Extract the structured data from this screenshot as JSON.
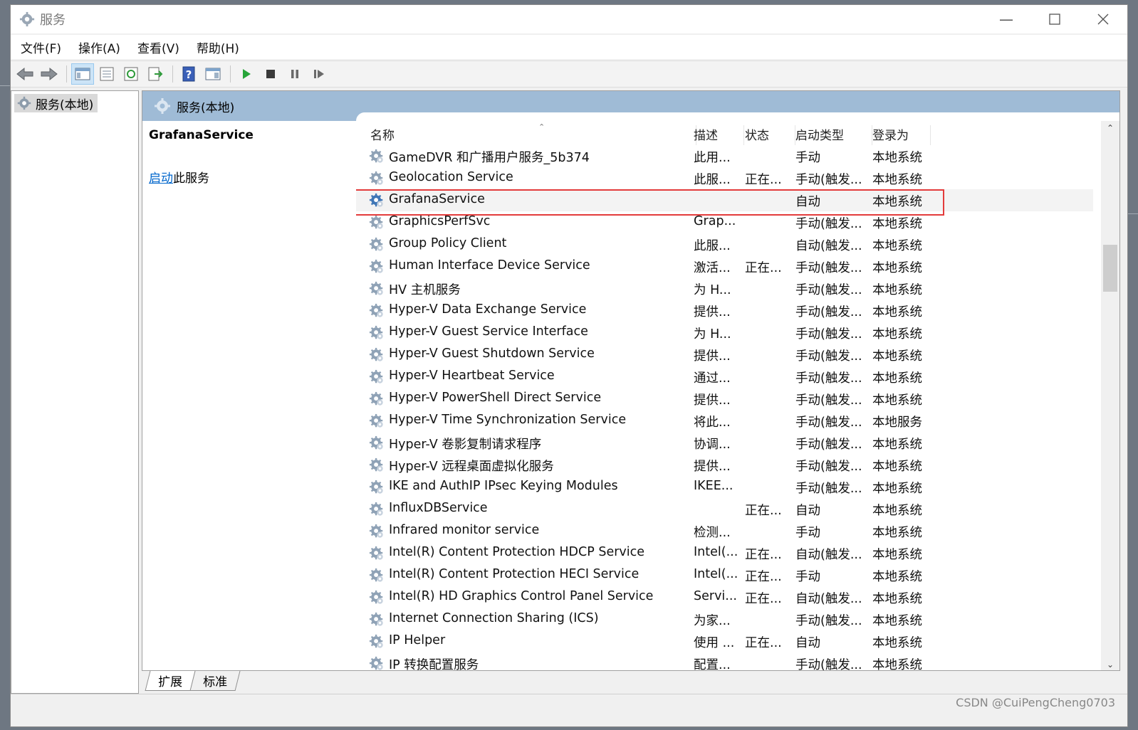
{
  "window": {
    "title": "服务"
  },
  "menu": [
    "文件(F)",
    "操作(A)",
    "查看(V)",
    "帮助(H)"
  ],
  "toolbar_icons": [
    "back-icon",
    "forward-icon",
    "show-tree-icon",
    "properties-icon",
    "refresh-icon",
    "export-list-icon",
    "help-icon",
    "console-tree-icon",
    "start-service-icon",
    "stop-service-icon",
    "pause-service-icon",
    "resume-service-icon"
  ],
  "tree": {
    "root": "服务(本地)"
  },
  "pane": {
    "header": "服务(本地)",
    "selected_name": "GrafanaService",
    "start_link": "启动",
    "start_rest": "此服务"
  },
  "columns": [
    "名称",
    "描述",
    "状态",
    "启动类型",
    "登录为"
  ],
  "rows": [
    {
      "name": "GameDVR 和广播用户服务_5b374",
      "desc": "此用...",
      "status": "",
      "startup": "手动",
      "logon": "本地系统"
    },
    {
      "name": "Geolocation Service",
      "desc": "此服...",
      "status": "正在...",
      "startup": "手动(触发...",
      "logon": "本地系统"
    },
    {
      "name": "GrafanaService",
      "desc": "",
      "status": "",
      "startup": "自动",
      "logon": "本地系统"
    },
    {
      "name": "GraphicsPerfSvc",
      "desc": "Grap...",
      "status": "",
      "startup": "手动(触发...",
      "logon": "本地系统"
    },
    {
      "name": "Group Policy Client",
      "desc": "此服...",
      "status": "",
      "startup": "自动(触发...",
      "logon": "本地系统"
    },
    {
      "name": "Human Interface Device Service",
      "desc": "激活...",
      "status": "正在...",
      "startup": "手动(触发...",
      "logon": "本地系统"
    },
    {
      "name": "HV 主机服务",
      "desc": "为 H...",
      "status": "",
      "startup": "手动(触发...",
      "logon": "本地系统"
    },
    {
      "name": "Hyper-V Data Exchange Service",
      "desc": "提供...",
      "status": "",
      "startup": "手动(触发...",
      "logon": "本地系统"
    },
    {
      "name": "Hyper-V Guest Service Interface",
      "desc": "为 H...",
      "status": "",
      "startup": "手动(触发...",
      "logon": "本地系统"
    },
    {
      "name": "Hyper-V Guest Shutdown Service",
      "desc": "提供...",
      "status": "",
      "startup": "手动(触发...",
      "logon": "本地系统"
    },
    {
      "name": "Hyper-V Heartbeat Service",
      "desc": "通过...",
      "status": "",
      "startup": "手动(触发...",
      "logon": "本地系统"
    },
    {
      "name": "Hyper-V PowerShell Direct Service",
      "desc": "提供...",
      "status": "",
      "startup": "手动(触发...",
      "logon": "本地系统"
    },
    {
      "name": "Hyper-V Time Synchronization Service",
      "desc": "将此...",
      "status": "",
      "startup": "手动(触发...",
      "logon": "本地服务"
    },
    {
      "name": "Hyper-V 卷影复制请求程序",
      "desc": "协调...",
      "status": "",
      "startup": "手动(触发...",
      "logon": "本地系统"
    },
    {
      "name": "Hyper-V 远程桌面虚拟化服务",
      "desc": "提供...",
      "status": "",
      "startup": "手动(触发...",
      "logon": "本地系统"
    },
    {
      "name": "IKE and AuthIP IPsec Keying Modules",
      "desc": "IKEE...",
      "status": "",
      "startup": "手动(触发...",
      "logon": "本地系统"
    },
    {
      "name": "InfluxDBService",
      "desc": "",
      "status": "正在...",
      "startup": "自动",
      "logon": "本地系统"
    },
    {
      "name": "Infrared monitor service",
      "desc": "检测...",
      "status": "",
      "startup": "手动",
      "logon": "本地系统"
    },
    {
      "name": "Intel(R) Content Protection HDCP Service",
      "desc": "Intel(...",
      "status": "正在...",
      "startup": "自动(触发...",
      "logon": "本地系统"
    },
    {
      "name": "Intel(R) Content Protection HECI Service",
      "desc": "Intel(...",
      "status": "正在...",
      "startup": "手动",
      "logon": "本地系统"
    },
    {
      "name": "Intel(R) HD Graphics Control Panel Service",
      "desc": "Servi...",
      "status": "正在...",
      "startup": "自动(触发...",
      "logon": "本地系统"
    },
    {
      "name": "Internet Connection Sharing (ICS)",
      "desc": "为家...",
      "status": "",
      "startup": "手动(触发...",
      "logon": "本地系统"
    },
    {
      "name": "IP Helper",
      "desc": "使用 ...",
      "status": "正在...",
      "startup": "自动",
      "logon": "本地系统"
    },
    {
      "name": "IP 转换配置服务",
      "desc": "配置...",
      "status": "",
      "startup": "手动(触发...",
      "logon": "本地系统"
    }
  ],
  "selected_row": 2,
  "tabs": [
    "扩展",
    "标准"
  ],
  "watermark": "CSDN @CuiPengCheng0703",
  "colors": {
    "highlight": "#e33b3b",
    "pane_header": "#9fbbd6",
    "link": "#0066cc"
  }
}
